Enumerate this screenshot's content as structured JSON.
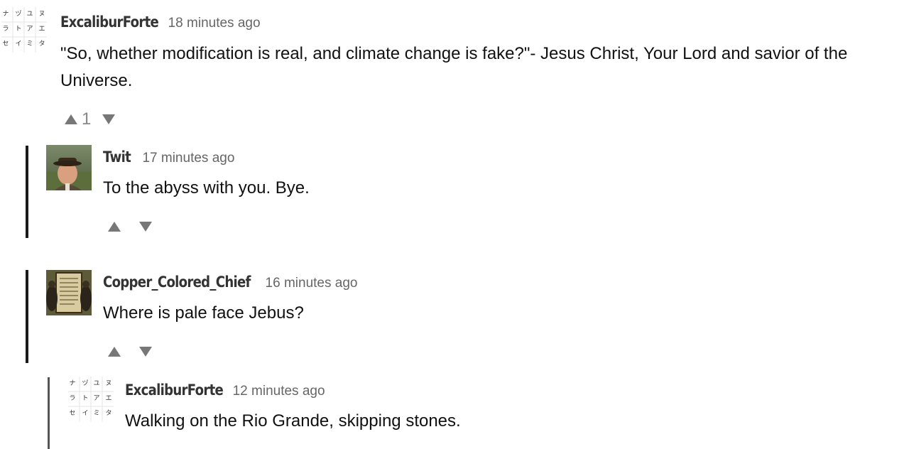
{
  "comments": [
    {
      "username": "ExcaliburForte",
      "time": "18 minutes ago",
      "text": "\"So, whether modification is real, and climate change is fake?\"- Jesus Christ, Your Lord and savior of the Universe.",
      "upvotes": "1",
      "avatar": "katakana-grid-avatar"
    },
    {
      "username": "Twit",
      "time": "17 minutes ago",
      "text": "To the abyss with you. Bye.",
      "upvotes": "",
      "avatar": "man-in-hat-photo-avatar"
    },
    {
      "username": "Copper_Colored_Chief",
      "time": "16 minutes ago",
      "text": "Where is pale face Jebus?",
      "upvotes": "",
      "avatar": "framed-document-avatar"
    },
    {
      "username": "ExcaliburForte",
      "time": "12 minutes ago",
      "text": "Walking on the Rio Grande, skipping stones.",
      "upvotes": "",
      "avatar": "katakana-grid-avatar"
    }
  ],
  "avatar_glyphs": [
    "ナ",
    "ヅ",
    "ユ",
    "ヌ",
    "ラ",
    "ト",
    "ア",
    "エ",
    "セ",
    "イ",
    "ミ",
    "タ"
  ],
  "colors": {
    "thread_bar": "#1a1a1a",
    "vote_arrow": "#777777",
    "username": "#333333",
    "timestamp": "#666666"
  }
}
